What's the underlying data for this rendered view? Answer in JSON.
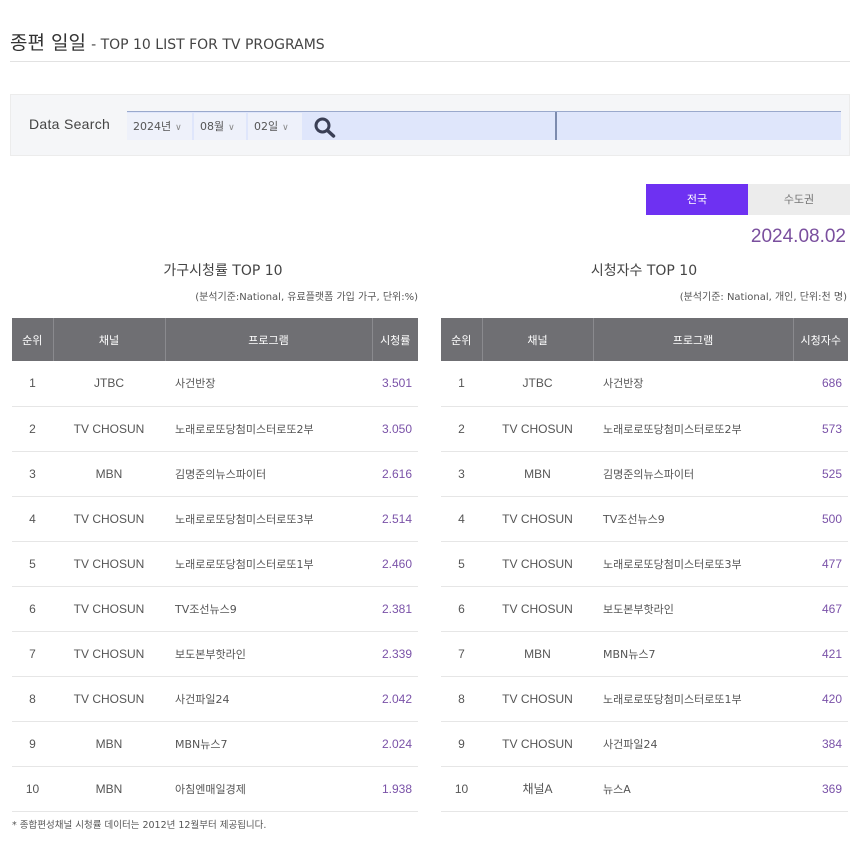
{
  "header": {
    "title_ko": "종편 일일",
    "title_en": "- TOP 10 LIST FOR TV PROGRAMS"
  },
  "search": {
    "label": "Data Search",
    "year": "2024년",
    "month": "08월",
    "day": "02일",
    "chevron": "∨",
    "icon": "search-icon"
  },
  "region_tabs": {
    "active": "전국",
    "inactive": "수도권",
    "accent_color": "#6e31f2"
  },
  "date_display": "2024.08.02",
  "household": {
    "title": "가구시청률 TOP 10",
    "note": "(분석기준:National, 유료플랫폼 가입 가구, 단위:%)",
    "columns": [
      "순위",
      "채널",
      "프로그램",
      "시청률"
    ],
    "rows": [
      {
        "rank": "1",
        "channel": "JTBC",
        "program": "사건반장",
        "value": "3.501"
      },
      {
        "rank": "2",
        "channel": "TV CHOSUN",
        "program": "노래로로또당첨미스터로또2부",
        "value": "3.050"
      },
      {
        "rank": "3",
        "channel": "MBN",
        "program": "김명준의뉴스파이터",
        "value": "2.616"
      },
      {
        "rank": "4",
        "channel": "TV CHOSUN",
        "program": "노래로로또당첨미스터로또3부",
        "value": "2.514"
      },
      {
        "rank": "5",
        "channel": "TV CHOSUN",
        "program": "노래로로또당첨미스터로또1부",
        "value": "2.460"
      },
      {
        "rank": "6",
        "channel": "TV CHOSUN",
        "program": "TV조선뉴스9",
        "value": "2.381"
      },
      {
        "rank": "7",
        "channel": "TV CHOSUN",
        "program": "보도본부핫라인",
        "value": "2.339"
      },
      {
        "rank": "8",
        "channel": "TV CHOSUN",
        "program": "사건파일24",
        "value": "2.042"
      },
      {
        "rank": "9",
        "channel": "MBN",
        "program": "MBN뉴스7",
        "value": "2.024"
      },
      {
        "rank": "10",
        "channel": "MBN",
        "program": "아침엔매일경제",
        "value": "1.938"
      }
    ]
  },
  "viewers": {
    "title": "시청자수 TOP 10",
    "note": "(분석기준: National, 개인, 단위:천 명)",
    "columns": [
      "순위",
      "채널",
      "프로그램",
      "시청자수"
    ],
    "rows": [
      {
        "rank": "1",
        "channel": "JTBC",
        "program": "사건반장",
        "value": "686"
      },
      {
        "rank": "2",
        "channel": "TV CHOSUN",
        "program": "노래로로또당첨미스터로또2부",
        "value": "573"
      },
      {
        "rank": "3",
        "channel": "MBN",
        "program": "김명준의뉴스파이터",
        "value": "525"
      },
      {
        "rank": "4",
        "channel": "TV CHOSUN",
        "program": "TV조선뉴스9",
        "value": "500"
      },
      {
        "rank": "5",
        "channel": "TV CHOSUN",
        "program": "노래로로또당첨미스터로또3부",
        "value": "477"
      },
      {
        "rank": "6",
        "channel": "TV CHOSUN",
        "program": "보도본부핫라인",
        "value": "467"
      },
      {
        "rank": "7",
        "channel": "MBN",
        "program": "MBN뉴스7",
        "value": "421"
      },
      {
        "rank": "8",
        "channel": "TV CHOSUN",
        "program": "노래로로또당첨미스터로또1부",
        "value": "420"
      },
      {
        "rank": "9",
        "channel": "TV CHOSUN",
        "program": "사건파일24",
        "value": "384"
      },
      {
        "rank": "10",
        "channel": "채널A",
        "program": "뉴스A",
        "value": "369"
      }
    ]
  },
  "footnote": "* 종합편성채널 시청률 데이터는 2012년 12월부터 제공됩니다."
}
